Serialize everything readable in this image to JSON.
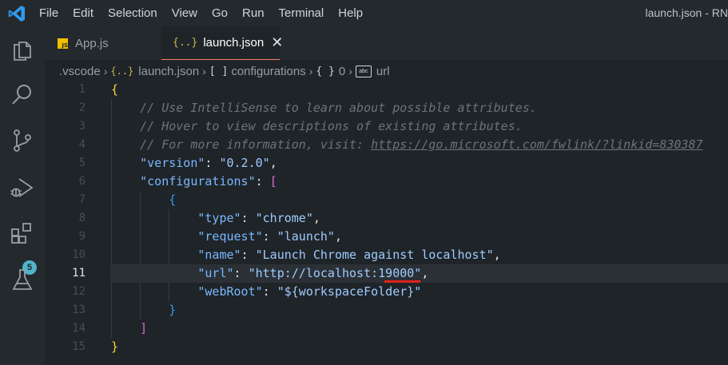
{
  "menu": [
    "File",
    "Edit",
    "Selection",
    "View",
    "Go",
    "Run",
    "Terminal",
    "Help"
  ],
  "window_title": "launch.json - RN",
  "activity": {
    "extensions_badge": "5"
  },
  "tabs": [
    {
      "label": "App.js",
      "icon": "js-icon",
      "active": false
    },
    {
      "label": "launch.json",
      "icon": "json-icon",
      "active": true
    }
  ],
  "breadcrumbs": {
    "folder": ".vscode",
    "file": "launch.json",
    "array": "configurations",
    "index": "0",
    "prop": "url",
    "json_glyph": "{..}",
    "array_glyph": "[ ]",
    "object_glyph": "{ }",
    "abc_glyph": "abc"
  },
  "editor": {
    "current_line": 11,
    "line_numbers": [
      "1",
      "2",
      "3",
      "4",
      "5",
      "6",
      "7",
      "8",
      "9",
      "10",
      "11",
      "12",
      "13",
      "14",
      "15"
    ],
    "comments": [
      "// Use IntelliSense to learn about possible attributes.",
      "// Hover to view descriptions of existing attributes.",
      "// For more information, visit: "
    ],
    "comment_link": "https://go.microsoft.com/fwlink/?linkid=830387",
    "version_key": "\"version\"",
    "version_value": "\"0.2.0\"",
    "configurations_key": "\"configurations\"",
    "type_key": "\"type\"",
    "type_value": "\"chrome\"",
    "request_key": "\"request\"",
    "request_value": "\"launch\"",
    "name_key": "\"name\"",
    "name_value": "\"Launch Chrome against localhost\"",
    "url_key": "\"url\"",
    "url_value": "\"http://localhost:19000\"",
    "webroot_key": "\"webRoot\"",
    "webroot_value": "\"${workspaceFolder}\""
  },
  "colors": {
    "background": "#1f2428",
    "accent": "#f9826c",
    "annotation": "#e0221e"
  }
}
